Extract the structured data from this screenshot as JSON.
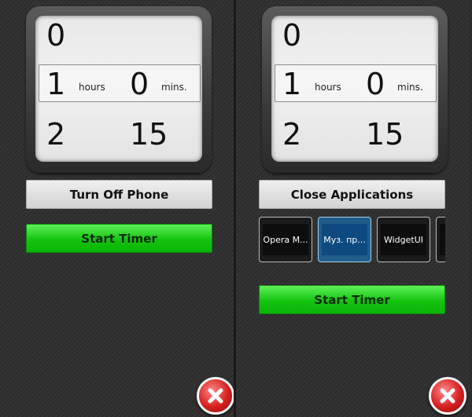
{
  "left_panel": {
    "picker": {
      "rows": [
        {
          "hours": "0",
          "minutes": ""
        },
        {
          "hours": "1",
          "minutes": "0"
        },
        {
          "hours": "2",
          "minutes": "15"
        }
      ],
      "hours_unit": "hours",
      "minutes_unit": "mins."
    },
    "action_button_label": "Turn Off Phone",
    "start_button_label": "Start Timer"
  },
  "right_panel": {
    "picker": {
      "rows": [
        {
          "hours": "0",
          "minutes": ""
        },
        {
          "hours": "1",
          "minutes": "0"
        },
        {
          "hours": "2",
          "minutes": "15"
        }
      ],
      "hours_unit": "hours",
      "minutes_unit": "mins."
    },
    "action_button_label": "Close Applications",
    "apps": [
      {
        "label": "Opera M...",
        "selected": false
      },
      {
        "label": "Муз. пр...",
        "selected": true
      },
      {
        "label": "WidgetUI",
        "selected": false
      },
      {
        "label": "V",
        "selected": false
      }
    ],
    "start_button_label": "Start Timer"
  },
  "colors": {
    "start_green": "#13c40f",
    "selected_app_blue": "#0c4a80",
    "close_red": "#d62020"
  },
  "icons": {
    "close": "close-x-icon"
  }
}
